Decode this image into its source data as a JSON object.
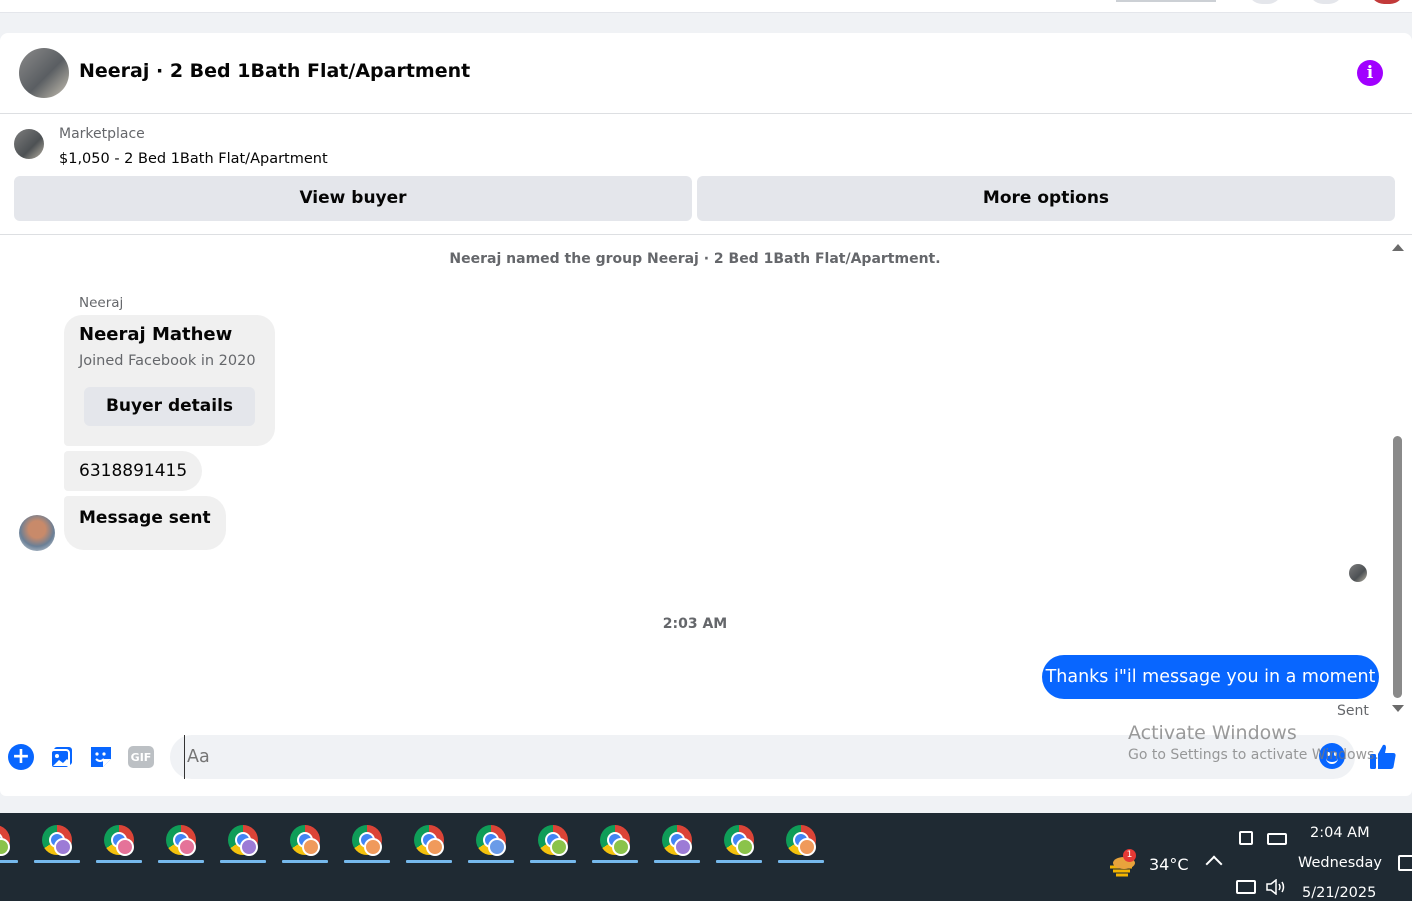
{
  "chat": {
    "title": "Neeraj · 2 Bed 1Bath Flat/Apartment",
    "info_icon": "info-icon",
    "accent_color": "#a100ff"
  },
  "marketplace": {
    "label": "Marketplace",
    "listing": "$1,050 - 2 Bed 1Bath Flat/Apartment",
    "view_buyer_label": "View buyer",
    "more_options_label": "More options"
  },
  "thread": {
    "system_message": "Neeraj named the group Neeraj · 2 Bed 1Bath Flat/Apartment.",
    "sender_name": "Neeraj",
    "buyer_card": {
      "name": "Neeraj Mathew",
      "joined": "Joined Facebook in 2020",
      "button_label": "Buyer details"
    },
    "phone_message": "6318891415",
    "message_sent": "Message sent",
    "timestamp": "2:03 AM",
    "outgoing_message": "Thanks i\"il message you in a moment",
    "status": "Sent",
    "outgoing_color": "#0866ff"
  },
  "composer": {
    "placeholder": "Aa",
    "icons": [
      "plus-icon",
      "photo-icon",
      "sticker-icon",
      "gif-icon",
      "emoji-icon",
      "thumbs-up-icon"
    ],
    "gif_label": "GIF"
  },
  "watermark": {
    "line1": "Activate Windows",
    "line2": "Go to Settings to activate Windows."
  },
  "taskbar": {
    "app_count": 14,
    "profile_colors": [
      "#8bc34a",
      "#9c7bd6",
      "#e57399",
      "#e57399",
      "#9c7bd6",
      "#f09a5b",
      "#f09a5b",
      "#f09a5b",
      "#6a9be8",
      "#8bc34a",
      "#8bc34a",
      "#9c7bd6",
      "#8bc34a",
      "#f09a5b"
    ],
    "temperature": "34°C",
    "weather_badge": "1",
    "time": "2:04 AM",
    "day": "Wednesday",
    "date": "5/21/2025"
  }
}
